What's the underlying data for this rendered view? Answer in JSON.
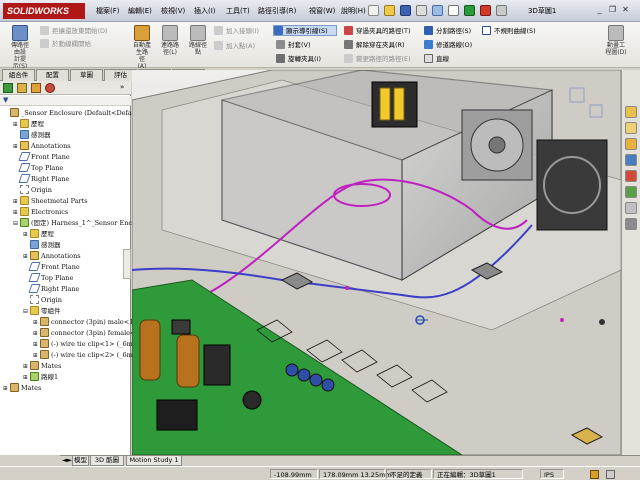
{
  "app": {
    "logo": "SOLIDWORKS",
    "doc_title": "3D草圖1"
  },
  "menu": [
    "檔案(F)",
    "編輯(E)",
    "檢視(V)",
    "插入(I)",
    "工具(T)",
    "路徑引導(R)",
    "視窗(W)",
    "說明(H)"
  ],
  "commands": {
    "start_route": "傳路徑\n由設\n計提\n示(S)",
    "edit_route_disabled": "拒攘還放東開始(D)",
    "disable_start_routing_disabled": "於動線欄開始",
    "auto_route": "自動產\n生路\n徑\n(A)",
    "route_through": "連路路\n徑(L)",
    "route_sketch": "路線徑\n點",
    "add_point_disabled": "加入接頭(I)",
    "add_point2_disabled": "加入點(A)",
    "show_guide": "顯示導引線(S)",
    "cover": "封套(V)",
    "rotate_clip": "旋轉夾具(I)",
    "through_clip": "穿過夾具的路徑(T)",
    "release_clip": "解除穿在夾具(R)",
    "route_disabled": "變更路徑的路徑(E)",
    "split_route": "分割路徑(S)",
    "repair_route": "修道路線(O)",
    "straight": "直線",
    "irregular_route": "不規則曲線(S)",
    "sketch_ring": "動畫工\n程圖(D)"
  },
  "tabs": [
    "組合件",
    "配置",
    "草圖",
    "評估",
    "電路",
    "軟體"
  ],
  "active_tab": 5,
  "tree": [
    {
      "label": "_Sensor Enclosure  (Default<Default_D",
      "exp": "",
      "icon": "cube",
      "indent": 0
    },
    {
      "label": "歷程",
      "exp": "+",
      "icon": "fold",
      "indent": 1
    },
    {
      "label": "感測器",
      "exp": "",
      "icon": "sens",
      "indent": 1
    },
    {
      "label": "Annotations",
      "exp": "+",
      "icon": "annot",
      "indent": 1
    },
    {
      "label": "Front Plane",
      "exp": "",
      "icon": "plane",
      "indent": 1
    },
    {
      "label": "Top Plane",
      "exp": "",
      "icon": "plane",
      "indent": 1
    },
    {
      "label": "Right Plane",
      "exp": "",
      "icon": "plane",
      "indent": 1
    },
    {
      "label": "Origin",
      "exp": "",
      "icon": "orig",
      "indent": 1
    },
    {
      "label": "Sheetmetal Parts",
      "exp": "+",
      "icon": "fold",
      "indent": 1
    },
    {
      "label": "Electronics",
      "exp": "+",
      "icon": "fold",
      "indent": 1
    },
    {
      "label": "(固定) Harness_1^_Sensor Enclosu",
      "exp": "-",
      "icon": "greenwire",
      "indent": 1
    },
    {
      "label": "歷程",
      "exp": "+",
      "icon": "fold",
      "indent": 2
    },
    {
      "label": "感測器",
      "exp": "",
      "icon": "sens",
      "indent": 2
    },
    {
      "label": "Annotations",
      "exp": "+",
      "icon": "annot",
      "indent": 2
    },
    {
      "label": "Front Plane",
      "exp": "",
      "icon": "plane",
      "indent": 2
    },
    {
      "label": "Top Plane",
      "exp": "",
      "icon": "plane",
      "indent": 2
    },
    {
      "label": "Right Plane",
      "exp": "",
      "icon": "plane",
      "indent": 2
    },
    {
      "label": "Origin",
      "exp": "",
      "icon": "orig",
      "indent": 2
    },
    {
      "label": "零組件",
      "exp": "-",
      "icon": "fold",
      "indent": 2
    },
    {
      "label": "connector (3pin) male<1>",
      "exp": "+",
      "icon": "cube",
      "indent": 3
    },
    {
      "label": "connector (3pin) female<1",
      "exp": "+",
      "icon": "cube",
      "indent": 3
    },
    {
      "label": "(-) wire tie clip<1> (_6mm",
      "exp": "+",
      "icon": "cube",
      "indent": 3
    },
    {
      "label": "(-) wire tie clip<2> (_6mm",
      "exp": "+",
      "icon": "cube",
      "indent": 3
    },
    {
      "label": "Mates",
      "exp": "+",
      "icon": "cube",
      "indent": 2
    },
    {
      "label": "路線1",
      "exp": "+",
      "icon": "greenwire",
      "indent": 2
    },
    {
      "label": "Mates",
      "exp": "+",
      "icon": "cube",
      "indent": 0
    }
  ],
  "bottom_tabs": [
    "模型",
    "3D 酷圖",
    "Motion Study 1"
  ],
  "status": {
    "x": "-108.99mm",
    "y": "178.09mm 13.25mm",
    "state": "不足的定義",
    "editing": "正在編輯：3D草圖1",
    "units": "IPS"
  }
}
